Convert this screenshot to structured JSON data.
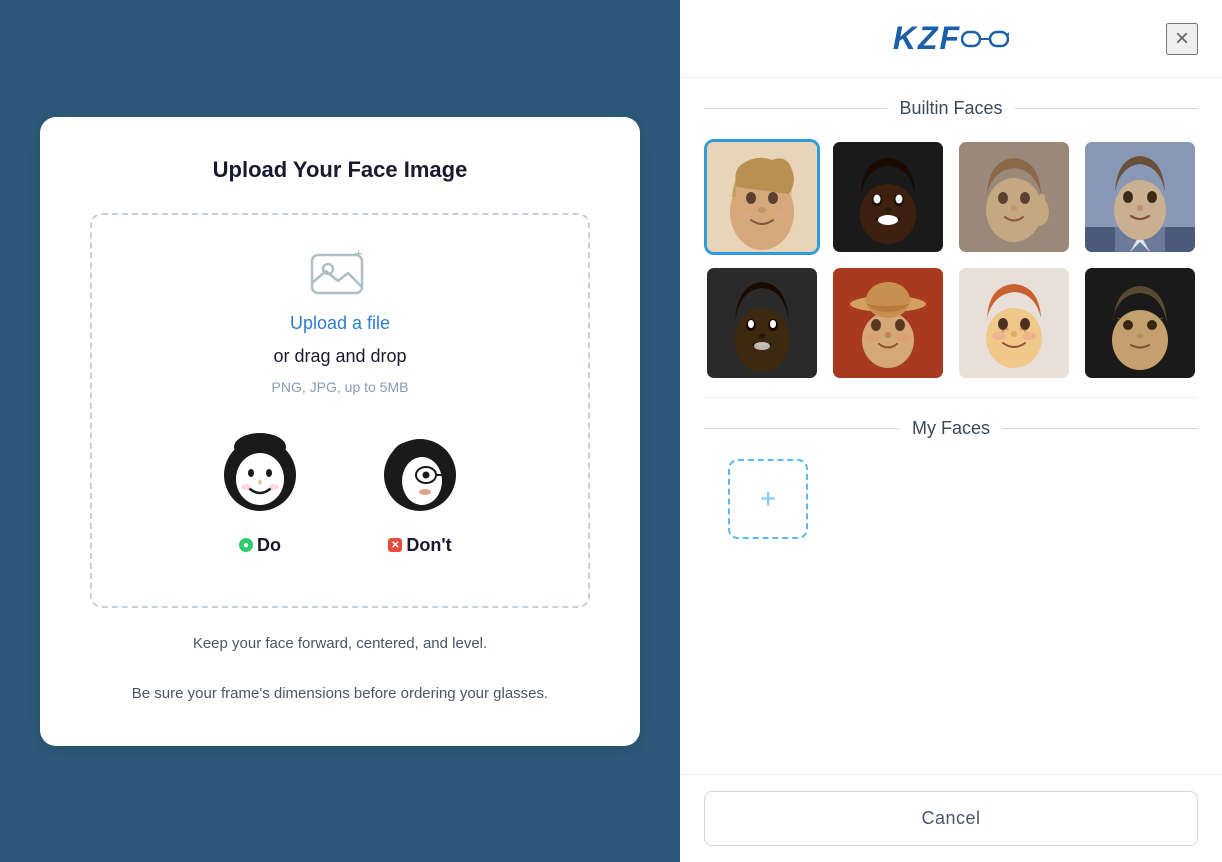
{
  "app": {
    "logo": "KZFOO",
    "close_label": "×"
  },
  "left_panel": {
    "title": "Upload Your Face Image",
    "upload_link": "Upload a file",
    "drag_drop": "or drag and drop",
    "file_types": "PNG, JPG, up to 5MB",
    "do_label": "Do",
    "dont_label": "Don't",
    "hint1": "Keep your face forward, centered, and level.",
    "hint2": "Be sure your frame's dimensions before ordering your glasses."
  },
  "right_panel": {
    "builtin_section_title": "Builtin Faces",
    "my_faces_section_title": "My Faces",
    "cancel_label": "Cancel",
    "faces": [
      {
        "id": 1,
        "selected": true,
        "color": "#c4a878",
        "skin": "#d4a574"
      },
      {
        "id": 2,
        "selected": false,
        "color": "#2a2a2a",
        "skin": "#4a3a2a"
      },
      {
        "id": 3,
        "selected": false,
        "color": "#9a8878",
        "skin": "#c4a882"
      },
      {
        "id": 4,
        "selected": false,
        "color": "#8a9ab5",
        "skin": "#a8b8d0"
      },
      {
        "id": 5,
        "selected": false,
        "color": "#3d3d3d",
        "skin": "#5a4a3a"
      },
      {
        "id": 6,
        "selected": false,
        "color": "#b5442a",
        "skin": "#c4785a"
      },
      {
        "id": 7,
        "selected": false,
        "color": "#d4a878",
        "skin": "#e8c090"
      },
      {
        "id": 8,
        "selected": false,
        "color": "#1a1a1a",
        "skin": "#6a5a4a"
      }
    ]
  }
}
